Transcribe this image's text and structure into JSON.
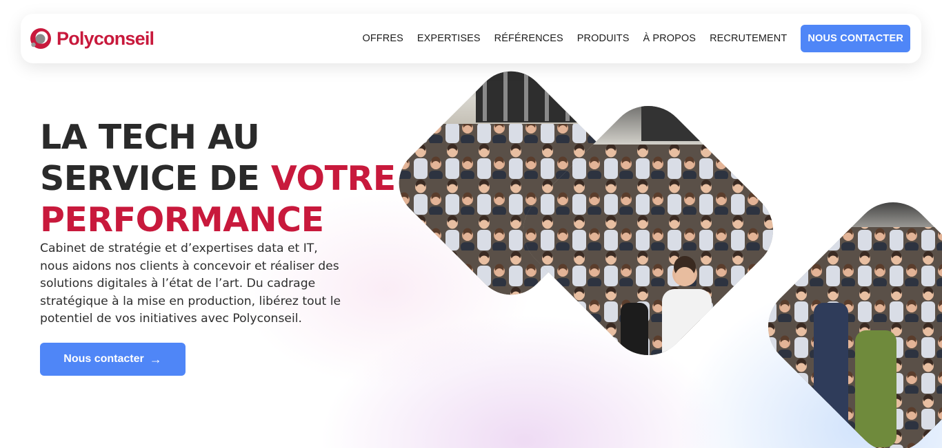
{
  "brand": {
    "name": "Polyconseil",
    "accent_color": "#c8193c",
    "button_color": "#4f86f7"
  },
  "nav": {
    "items": [
      "OFFRES",
      "EXPERTISES",
      "RÉFÉRENCES",
      "PRODUITS",
      "À PROPOS",
      "RECRUTEMENT"
    ],
    "cta": "NOUS CONTACTER"
  },
  "hero": {
    "title_line1": "LA TECH AU",
    "title_line2_plain": "SERVICE DE ",
    "title_line2_accent": "VOTRE",
    "title_line3_accent": "PERFORMANCE",
    "description": "Cabinet de stratégie et d’expertises data et IT, nous aidons nos clients à concevoir et réaliser des solutions digitales à l’état de l’art. Du cadrage stratégique à la mise en production, libérez tout le potentiel de vos initiatives avec Polyconseil.",
    "cta_label": "Nous contacter",
    "cta_icon": "arrow-right-icon"
  }
}
